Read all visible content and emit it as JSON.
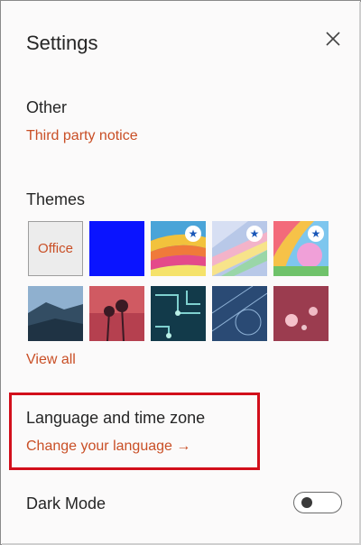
{
  "panel": {
    "title": "Settings",
    "close_icon": "close-icon"
  },
  "other": {
    "heading": "Other",
    "third_party_link": "Third party notice"
  },
  "themes": {
    "heading": "Themes",
    "selected_tile_label": "Office",
    "view_all_link": "View all"
  },
  "language": {
    "heading": "Language and time zone",
    "change_link": "Change your language →"
  },
  "dark_mode": {
    "label": "Dark Mode",
    "enabled": false
  },
  "colors": {
    "accent_link": "#c94f26",
    "highlight_box": "#d20f1b"
  }
}
